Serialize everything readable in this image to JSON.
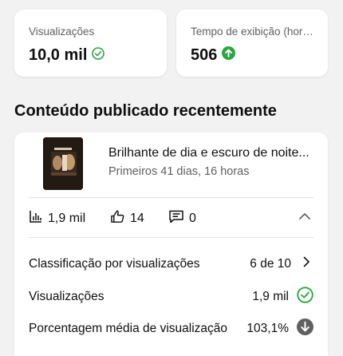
{
  "stats": {
    "views": {
      "label": "Visualizações",
      "value": "10,0 mil",
      "status_icon": "check-circle-icon",
      "status_color": "#2ba640"
    },
    "watch_time": {
      "label": "Tempo de exibição (horas)",
      "value": "506",
      "status_icon": "arrow-up-circle-icon",
      "status_color": "#2ba640"
    }
  },
  "section_title": "Conteúdo publicado recentemente",
  "video": {
    "title": "Brilhante de dia e escuro de noite...",
    "subtitle": "Primeiros 41 dias, 16 horas",
    "metrics": {
      "views": "1,9 mil",
      "likes": "14",
      "comments": "0"
    },
    "rows": [
      {
        "label": "Classificação por visualizações",
        "value": "6 de 10",
        "icon": "chevron-right-icon"
      },
      {
        "label": "Visualizações",
        "value": "1,9 mil",
        "icon": "check-circle-icon"
      },
      {
        "label": "Porcentagem média de visualização",
        "value": "103,1%",
        "icon": "arrow-down-circle-icon"
      }
    ]
  },
  "colors": {
    "positive": "#2ba640",
    "neutral": "#606060"
  }
}
